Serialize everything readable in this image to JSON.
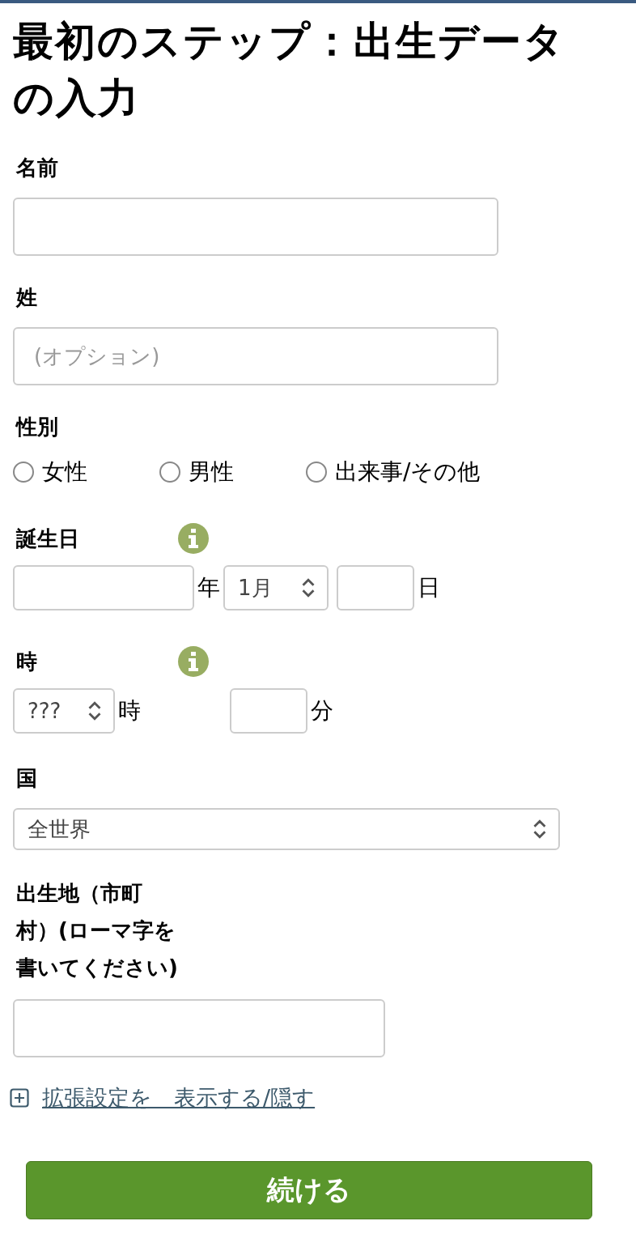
{
  "title": "最初のステップ：出生データの入力",
  "first_name": {
    "label": "名前"
  },
  "last_name": {
    "label": "姓",
    "placeholder": "(オプション)"
  },
  "gender": {
    "label": "性別",
    "options": [
      {
        "label": "女性",
        "selected": false
      },
      {
        "label": "男性",
        "selected": false
      },
      {
        "label": "出来事/その他",
        "selected": false
      }
    ]
  },
  "birthday": {
    "label": "誕生日",
    "year_unit": "年",
    "month": "1月",
    "day_unit": "日"
  },
  "time": {
    "label": "時",
    "hour": "???",
    "hour_unit": "時",
    "minute_unit": "分"
  },
  "country": {
    "label": "国",
    "value": "全世界"
  },
  "birthplace": {
    "label": "出生地（市町村）(ローマ字を書いてください)"
  },
  "advanced_link": "拡張設定を　表示する/隠す",
  "continue_button": "続ける"
}
